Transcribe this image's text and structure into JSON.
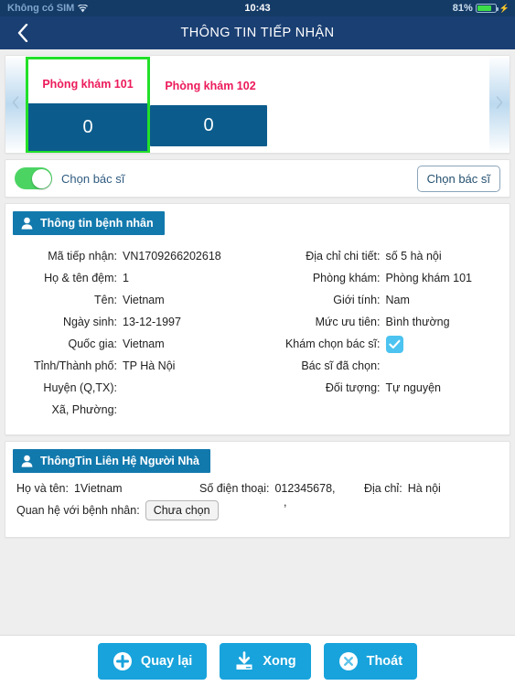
{
  "status_bar": {
    "carrier": "Không có SIM",
    "wifi_icon": "wifi-icon",
    "time": "10:43",
    "battery_percent": "81%",
    "battery_level": 81,
    "charging_icon": "lightning-bolt-icon"
  },
  "nav": {
    "back_icon": "chevron-left-icon",
    "title": "THÔNG TIN TIẾP NHẬN"
  },
  "carousel": {
    "prev_icon": "chevron-left-icon",
    "next_icon": "chevron-right-icon",
    "selected_color": "#22e02a",
    "name_color": "#ec1a5b",
    "count_color": "#0b5c8c",
    "rooms": [
      {
        "name": "Phòng khám 101",
        "count": "0",
        "selected": true
      },
      {
        "name": "Phòng khám 102",
        "count": "0",
        "selected": false
      }
    ]
  },
  "doctor_toggle": {
    "toggle_state": "on",
    "toggle_color": "#4cd463",
    "label": "Chọn bác sĩ",
    "button_label": "Chọn bác sĩ"
  },
  "patient_panel": {
    "icon": "person-icon",
    "title": "Thông tin bệnh nhân",
    "header_color": "#1279ad",
    "left_fields": [
      {
        "label": "Mã tiếp nhận:",
        "value": "VN1709266202618"
      },
      {
        "label": "Họ & tên đệm:",
        "value": "1"
      },
      {
        "label": "Tên:",
        "value": "Vietnam"
      },
      {
        "label": "Ngày sinh:",
        "value": "13-12-1997"
      },
      {
        "label": "Quốc gia:",
        "value": "Vietnam"
      },
      {
        "label": "Tỉnh/Thành phố:",
        "value": "TP Hà Nội"
      },
      {
        "label": "Huyện (Q,TX):",
        "value": ""
      },
      {
        "label": "Xã, Phường:",
        "value": ""
      }
    ],
    "right_fields": [
      {
        "label": "Địa chỉ chi tiết:",
        "value": "số 5 hà nội"
      },
      {
        "label": "Phòng khám:",
        "value": "Phòng khám 101"
      },
      {
        "label": "Giới tính:",
        "value": "Nam"
      },
      {
        "label": "Mức ưu tiên:",
        "value": "Bình thường"
      },
      {
        "label": "Bác sĩ đã chọn:",
        "value": ""
      },
      {
        "label": "Đối tượng:",
        "value": "Tự nguyện"
      }
    ],
    "checkbox_field": {
      "label": "Khám chọn bác sĩ:",
      "checked": true,
      "color": "#4cc3f0",
      "icon": "checkmark-icon"
    }
  },
  "contact_panel": {
    "icon": "person-icon",
    "title": "ThôngTin Liên Hệ Người Nhà",
    "name_label": "Họ và tên:",
    "name_value": "1Vietnam",
    "phone_label": "Số điện thoại:",
    "phone_value": "012345678,",
    "phone_extra": ",",
    "address_label": "Địa chỉ:",
    "address_value": "Hà nội",
    "relation_label": "Quan hệ với bệnh nhân:",
    "relation_value": "Chưa chọn"
  },
  "bottom_bar": {
    "buttons": [
      {
        "label": "Quay lại",
        "icon": "plus-circle-icon"
      },
      {
        "label": "Xong",
        "icon": "download-icon"
      },
      {
        "label": "Thoát",
        "icon": "x-circle-icon"
      }
    ],
    "color": "#18a3dc"
  }
}
